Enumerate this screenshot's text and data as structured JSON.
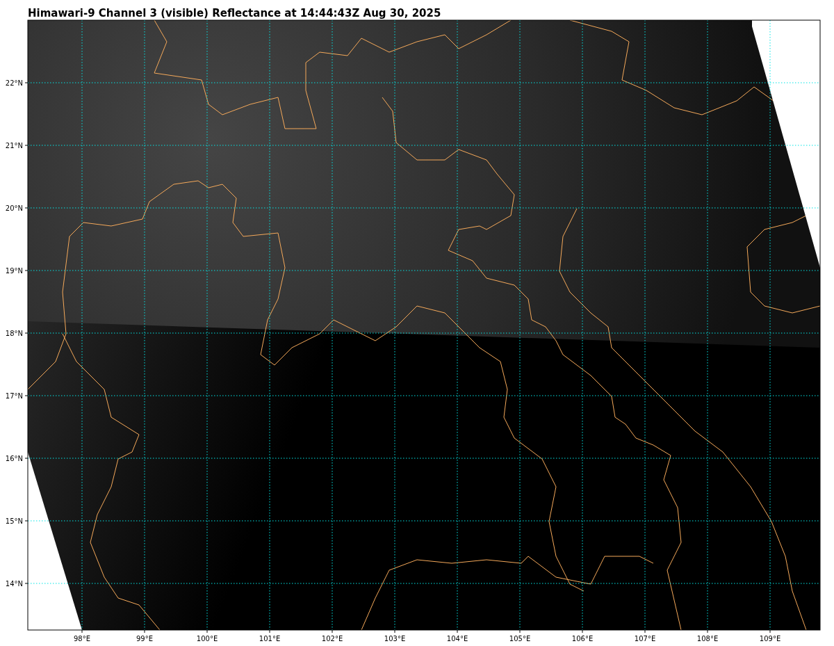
{
  "title": "Himawari-9 Channel 3 (visible) Reflectance at 14:44:43Z Aug 30, 2025",
  "map": {
    "lat_ticks": [
      "22°N",
      "21°N",
      "20°N",
      "19°N",
      "18°N",
      "17°N",
      "16°N",
      "15°N",
      "14°N"
    ],
    "lon_ticks": [
      "98°E",
      "99°E",
      "100°E",
      "101°E",
      "102°E",
      "103°E",
      "104°E",
      "105°E",
      "106°E",
      "107°E",
      "108°E",
      "109°E"
    ]
  }
}
